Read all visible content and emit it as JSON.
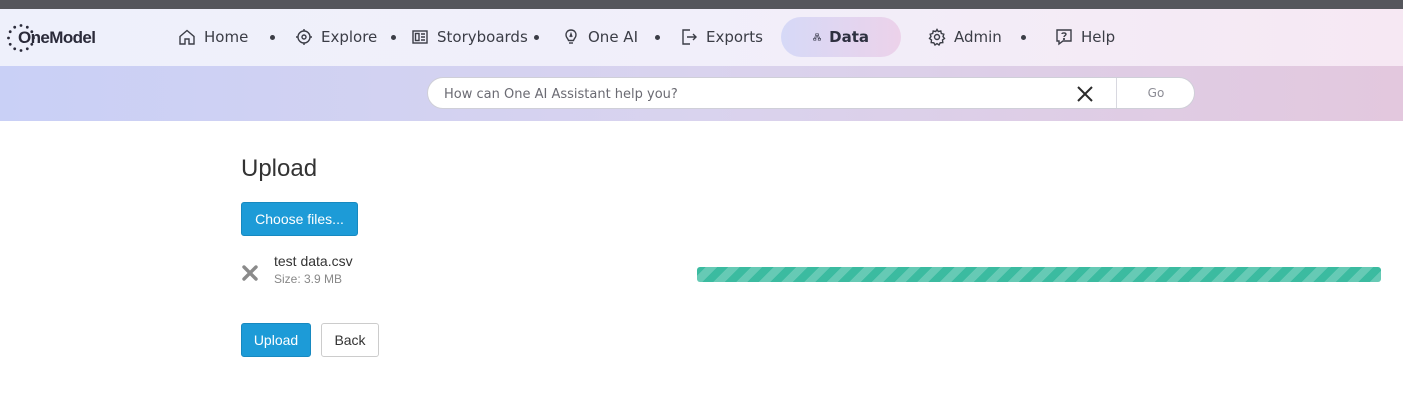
{
  "logo": {
    "text": "OneModel"
  },
  "nav": {
    "items": [
      {
        "label": "Home",
        "icon": "home-icon"
      },
      {
        "label": "Explore",
        "icon": "explore-icon"
      },
      {
        "label": "Storyboards",
        "icon": "storyboard-icon"
      },
      {
        "label": "One AI",
        "icon": "lightbulb-icon"
      },
      {
        "label": "Exports",
        "icon": "export-icon"
      },
      {
        "label": "Data",
        "icon": "data-hierarchy-icon",
        "active": true
      },
      {
        "label": "Admin",
        "icon": "gear-icon"
      },
      {
        "label": "Help",
        "icon": "help-chat-icon"
      }
    ]
  },
  "search": {
    "placeholder": "How can One AI Assistant help you?",
    "value": "",
    "go_label": "Go"
  },
  "upload": {
    "title": "Upload",
    "choose_label": "Choose files...",
    "file": {
      "name": "test data.csv",
      "size": "Size: 3.9 MB"
    },
    "progress_percent": 100,
    "upload_label": "Upload",
    "back_label": "Back"
  },
  "colors": {
    "primary": "#1d9bd7",
    "progress": "#3bbba0",
    "nav_text": "#3b3d46"
  }
}
